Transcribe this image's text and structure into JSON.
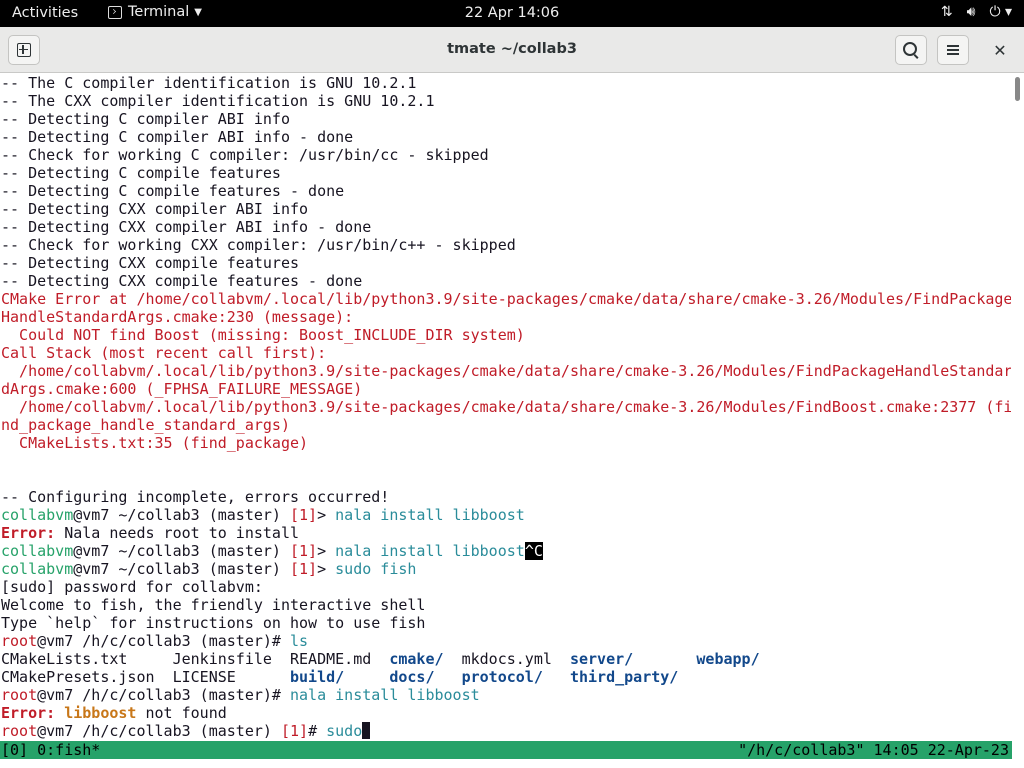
{
  "topbar": {
    "activities": "Activities",
    "app_name": "Terminal",
    "clock": "22 Apr  14:06"
  },
  "window": {
    "title": "tmate ~/collab3"
  },
  "terminal": {
    "lines": [
      {
        "segs": [
          {
            "t": "-- The C compiler identification is GNU 10.2.1",
            "c": ""
          }
        ]
      },
      {
        "segs": [
          {
            "t": "-- The CXX compiler identification is GNU 10.2.1",
            "c": ""
          }
        ]
      },
      {
        "segs": [
          {
            "t": "-- Detecting C compiler ABI info",
            "c": ""
          }
        ]
      },
      {
        "segs": [
          {
            "t": "-- Detecting C compiler ABI info - done",
            "c": ""
          }
        ]
      },
      {
        "segs": [
          {
            "t": "-- Check for working C compiler: /usr/bin/cc - skipped",
            "c": ""
          }
        ]
      },
      {
        "segs": [
          {
            "t": "-- Detecting C compile features",
            "c": ""
          }
        ]
      },
      {
        "segs": [
          {
            "t": "-- Detecting C compile features - done",
            "c": ""
          }
        ]
      },
      {
        "segs": [
          {
            "t": "-- Detecting CXX compiler ABI info",
            "c": ""
          }
        ]
      },
      {
        "segs": [
          {
            "t": "-- Detecting CXX compiler ABI info - done",
            "c": ""
          }
        ]
      },
      {
        "segs": [
          {
            "t": "-- Check for working CXX compiler: /usr/bin/c++ - skipped",
            "c": ""
          }
        ]
      },
      {
        "segs": [
          {
            "t": "-- Detecting CXX compile features",
            "c": ""
          }
        ]
      },
      {
        "segs": [
          {
            "t": "-- Detecting CXX compile features - done",
            "c": ""
          }
        ]
      },
      {
        "segs": [
          {
            "t": "CMake Error at /home/collabvm/.local/lib/python3.9/site-packages/cmake/data/share/cmake-3.26/Modules/FindPackage",
            "c": "err"
          }
        ]
      },
      {
        "segs": [
          {
            "t": "HandleStandardArgs.cmake:230 (message):",
            "c": "err"
          }
        ]
      },
      {
        "segs": [
          {
            "t": "  Could NOT find Boost (missing: Boost_INCLUDE_DIR system)",
            "c": "err"
          }
        ]
      },
      {
        "segs": [
          {
            "t": "Call Stack (most recent call first):",
            "c": "err"
          }
        ]
      },
      {
        "segs": [
          {
            "t": "  /home/collabvm/.local/lib/python3.9/site-packages/cmake/data/share/cmake-3.26/Modules/FindPackageHandleStandar",
            "c": "err"
          }
        ]
      },
      {
        "segs": [
          {
            "t": "dArgs.cmake:600 (_FPHSA_FAILURE_MESSAGE)",
            "c": "err"
          }
        ]
      },
      {
        "segs": [
          {
            "t": "  /home/collabvm/.local/lib/python3.9/site-packages/cmake/data/share/cmake-3.26/Modules/FindBoost.cmake:2377 (fi",
            "c": "err"
          }
        ]
      },
      {
        "segs": [
          {
            "t": "nd_package_handle_standard_args)",
            "c": "err"
          }
        ]
      },
      {
        "segs": [
          {
            "t": "  CMakeLists.txt:35 (find_package)",
            "c": "err"
          }
        ]
      },
      {
        "segs": []
      },
      {
        "segs": []
      },
      {
        "segs": [
          {
            "t": "-- Configuring incomplete, errors occurred!",
            "c": ""
          }
        ]
      },
      {
        "segs": [
          {
            "t": "collabvm",
            "c": "green"
          },
          {
            "t": "@vm7 ",
            "c": ""
          },
          {
            "t": "~/collab3",
            "c": ""
          },
          {
            "t": " (master) ",
            "c": ""
          },
          {
            "t": "[1]",
            "c": "err"
          },
          {
            "t": "> ",
            "c": ""
          },
          {
            "t": "nala install libboost",
            "c": "cyan"
          }
        ]
      },
      {
        "segs": [
          {
            "t": "Error:",
            "c": "errlbl"
          },
          {
            "t": " Nala needs root to install",
            "c": ""
          }
        ]
      },
      {
        "segs": [
          {
            "t": "collabvm",
            "c": "green"
          },
          {
            "t": "@vm7 ",
            "c": ""
          },
          {
            "t": "~/collab3",
            "c": ""
          },
          {
            "t": " (master) ",
            "c": ""
          },
          {
            "t": "[1]",
            "c": "err"
          },
          {
            "t": "> ",
            "c": ""
          },
          {
            "t": "nala install libboost",
            "c": "cyan"
          },
          {
            "t": "^C",
            "c": "ctrl"
          }
        ]
      },
      {
        "segs": [
          {
            "t": "collabvm",
            "c": "green"
          },
          {
            "t": "@vm7 ",
            "c": ""
          },
          {
            "t": "~/collab3",
            "c": ""
          },
          {
            "t": " (master) ",
            "c": ""
          },
          {
            "t": "[1]",
            "c": "err"
          },
          {
            "t": "> ",
            "c": ""
          },
          {
            "t": "sudo fish",
            "c": "cyan"
          }
        ]
      },
      {
        "segs": [
          {
            "t": "[sudo] password for collabvm:",
            "c": ""
          }
        ]
      },
      {
        "segs": [
          {
            "t": "Welcome to fish, the friendly interactive shell",
            "c": ""
          }
        ]
      },
      {
        "segs": [
          {
            "t": "Type `help` for instructions on how to use fish",
            "c": ""
          }
        ]
      },
      {
        "segs": [
          {
            "t": "root",
            "c": "err"
          },
          {
            "t": "@vm7 ",
            "c": ""
          },
          {
            "t": "/h/c/collab3",
            "c": ""
          },
          {
            "t": " (master)# ",
            "c": ""
          },
          {
            "t": "ls",
            "c": "cyan"
          }
        ]
      },
      {
        "segs": [
          {
            "t": "CMakeLists.txt     Jenkinsfile  README.md  ",
            "c": ""
          },
          {
            "t": "cmake/",
            "c": "blue bold"
          },
          {
            "t": "  mkdocs.yml  ",
            "c": ""
          },
          {
            "t": "server/",
            "c": "blue bold"
          },
          {
            "t": "       ",
            "c": ""
          },
          {
            "t": "webapp/",
            "c": "blue bold"
          }
        ]
      },
      {
        "segs": [
          {
            "t": "CMakePresets.json  LICENSE      ",
            "c": ""
          },
          {
            "t": "build/",
            "c": "blue bold"
          },
          {
            "t": "     ",
            "c": ""
          },
          {
            "t": "docs/",
            "c": "blue bold"
          },
          {
            "t": "   ",
            "c": ""
          },
          {
            "t": "protocol/",
            "c": "blue bold"
          },
          {
            "t": "   ",
            "c": ""
          },
          {
            "t": "third_party/",
            "c": "blue bold"
          }
        ]
      },
      {
        "segs": [
          {
            "t": "root",
            "c": "err"
          },
          {
            "t": "@vm7 ",
            "c": ""
          },
          {
            "t": "/h/c/collab3",
            "c": ""
          },
          {
            "t": " (master)# ",
            "c": ""
          },
          {
            "t": "nala install libboost",
            "c": "cyan"
          }
        ]
      },
      {
        "segs": [
          {
            "t": "Error:",
            "c": "errlbl"
          },
          {
            "t": " ",
            "c": ""
          },
          {
            "t": "libboost",
            "c": "orange"
          },
          {
            "t": " not found",
            "c": ""
          }
        ]
      },
      {
        "segs": [
          {
            "t": "root",
            "c": "err"
          },
          {
            "t": "@vm7 ",
            "c": ""
          },
          {
            "t": "/h/c/collab3",
            "c": ""
          },
          {
            "t": " (master) ",
            "c": ""
          },
          {
            "t": "[1]",
            "c": "err"
          },
          {
            "t": "# ",
            "c": ""
          },
          {
            "t": "sudo",
            "c": "cyan"
          },
          {
            "t": "",
            "c": "cursor"
          }
        ]
      }
    ],
    "status_left": "[0] 0:fish*",
    "status_right": "\"/h/c/collab3\" 14:05 22-Apr-23"
  },
  "colors": {
    "error_red": "#c01c28",
    "prompt_green": "#26a269",
    "command_cyan": "#2a8c9a",
    "dir_blue": "#12488b",
    "tmux_bar": "#26a269"
  },
  "icons": {
    "new_tab": "new-tab-icon",
    "search": "search-icon",
    "menu": "hamburger-menu-icon",
    "close": "close-icon",
    "network": "network-icon",
    "volume": "volume-icon",
    "power": "power-icon"
  }
}
